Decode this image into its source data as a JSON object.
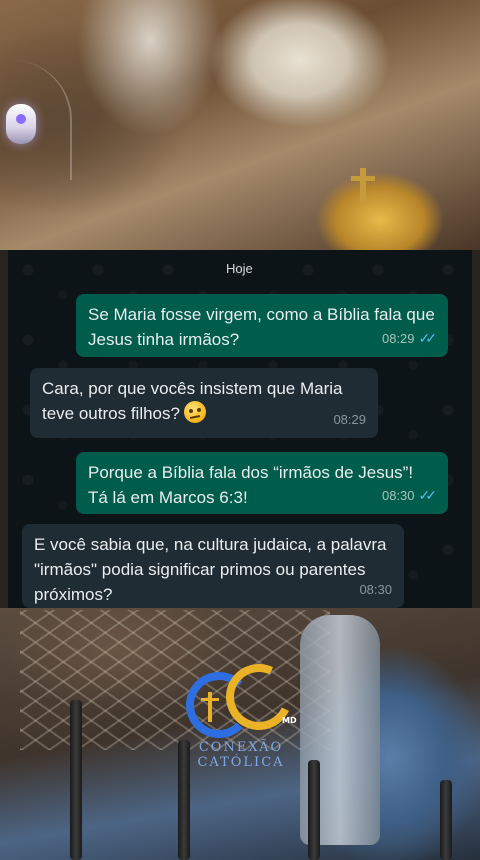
{
  "chat": {
    "date_label": "Hoje",
    "messages": [
      {
        "direction": "outgoing",
        "text": "Se Maria fosse virgem, como a Bíblia fala que Jesus tinha irmãos?",
        "time": "08:29",
        "status": "read"
      },
      {
        "direction": "incoming",
        "text": "Cara, por que vocês insistem que Maria teve outros filhos?",
        "emoji": "face-with-raised-eyebrow",
        "time": "08:29"
      },
      {
        "direction": "outgoing",
        "text": "Porque a Bíblia fala dos “irmãos de Jesus”! Tá lá em Marcos 6:3!",
        "time": "08:30",
        "status": "read"
      },
      {
        "direction": "incoming",
        "text": "E você sabia que, na cultura judaica, a palavra \"irmãos\" podia significar primos ou parentes próximos?",
        "time": "08:30"
      }
    ]
  },
  "logo": {
    "line1": "CONEXÃO",
    "line2": "CATÓLICA",
    "badge": "MD"
  },
  "colors": {
    "outgoing_bubble": "#005c4b",
    "incoming_bubble": "#202c33",
    "chat_background": "#0d1418",
    "read_ticks": "#53bdeb"
  }
}
